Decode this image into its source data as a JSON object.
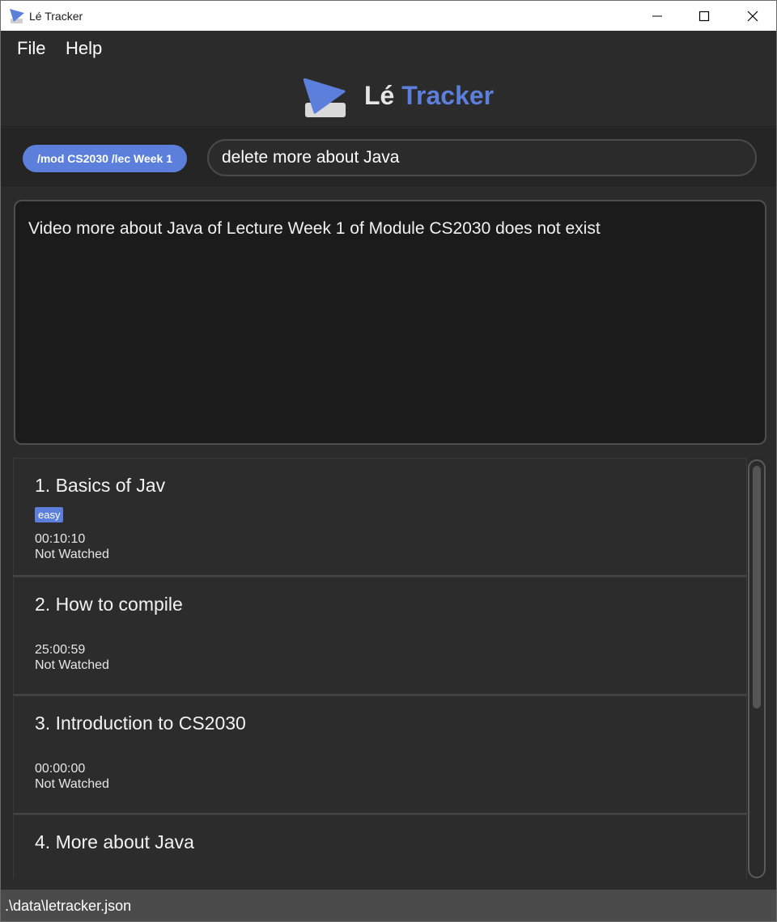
{
  "window": {
    "title": "Lé Tracker",
    "controls": {
      "minimize": "minimize-icon",
      "maximize": "maximize-icon",
      "close": "close-icon"
    }
  },
  "menu": {
    "items": [
      "File",
      "Help"
    ]
  },
  "header": {
    "logo_word1": "Lé",
    "logo_word2": "Tracker",
    "accent_color": "#5b7fdb"
  },
  "command": {
    "context_label": "/mod CS2030 /lec Week 1",
    "input_value": "delete more about Java"
  },
  "result": {
    "message": "Video more about Java of Lecture Week 1 of Module CS2030 does not exist"
  },
  "videos": [
    {
      "title": "1.  Basics of Jav",
      "tag": "easy",
      "duration": "00:10:10",
      "status": "Not Watched"
    },
    {
      "title": "2.  How to compile",
      "tag": "",
      "duration": "25:00:59",
      "status": "Not Watched"
    },
    {
      "title": "3.  Introduction to CS2030",
      "tag": "",
      "duration": "00:00:00",
      "status": "Not Watched"
    },
    {
      "title": "4.  More about Java",
      "tag": "",
      "duration": "",
      "status": ""
    }
  ],
  "status_bar": {
    "path": ".\\data\\letracker.json"
  }
}
